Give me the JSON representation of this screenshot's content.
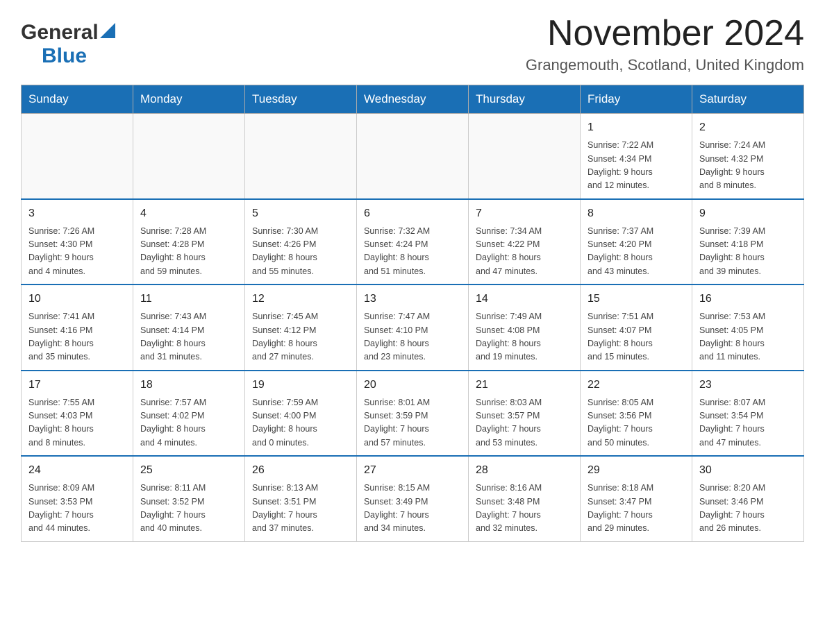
{
  "header": {
    "logo_general": "General",
    "logo_blue": "Blue",
    "month_title": "November 2024",
    "location": "Grangemouth, Scotland, United Kingdom"
  },
  "days_of_week": [
    "Sunday",
    "Monday",
    "Tuesday",
    "Wednesday",
    "Thursday",
    "Friday",
    "Saturday"
  ],
  "weeks": [
    [
      {
        "day": "",
        "info": ""
      },
      {
        "day": "",
        "info": ""
      },
      {
        "day": "",
        "info": ""
      },
      {
        "day": "",
        "info": ""
      },
      {
        "day": "",
        "info": ""
      },
      {
        "day": "1",
        "info": "Sunrise: 7:22 AM\nSunset: 4:34 PM\nDaylight: 9 hours\nand 12 minutes."
      },
      {
        "day": "2",
        "info": "Sunrise: 7:24 AM\nSunset: 4:32 PM\nDaylight: 9 hours\nand 8 minutes."
      }
    ],
    [
      {
        "day": "3",
        "info": "Sunrise: 7:26 AM\nSunset: 4:30 PM\nDaylight: 9 hours\nand 4 minutes."
      },
      {
        "day": "4",
        "info": "Sunrise: 7:28 AM\nSunset: 4:28 PM\nDaylight: 8 hours\nand 59 minutes."
      },
      {
        "day": "5",
        "info": "Sunrise: 7:30 AM\nSunset: 4:26 PM\nDaylight: 8 hours\nand 55 minutes."
      },
      {
        "day": "6",
        "info": "Sunrise: 7:32 AM\nSunset: 4:24 PM\nDaylight: 8 hours\nand 51 minutes."
      },
      {
        "day": "7",
        "info": "Sunrise: 7:34 AM\nSunset: 4:22 PM\nDaylight: 8 hours\nand 47 minutes."
      },
      {
        "day": "8",
        "info": "Sunrise: 7:37 AM\nSunset: 4:20 PM\nDaylight: 8 hours\nand 43 minutes."
      },
      {
        "day": "9",
        "info": "Sunrise: 7:39 AM\nSunset: 4:18 PM\nDaylight: 8 hours\nand 39 minutes."
      }
    ],
    [
      {
        "day": "10",
        "info": "Sunrise: 7:41 AM\nSunset: 4:16 PM\nDaylight: 8 hours\nand 35 minutes."
      },
      {
        "day": "11",
        "info": "Sunrise: 7:43 AM\nSunset: 4:14 PM\nDaylight: 8 hours\nand 31 minutes."
      },
      {
        "day": "12",
        "info": "Sunrise: 7:45 AM\nSunset: 4:12 PM\nDaylight: 8 hours\nand 27 minutes."
      },
      {
        "day": "13",
        "info": "Sunrise: 7:47 AM\nSunset: 4:10 PM\nDaylight: 8 hours\nand 23 minutes."
      },
      {
        "day": "14",
        "info": "Sunrise: 7:49 AM\nSunset: 4:08 PM\nDaylight: 8 hours\nand 19 minutes."
      },
      {
        "day": "15",
        "info": "Sunrise: 7:51 AM\nSunset: 4:07 PM\nDaylight: 8 hours\nand 15 minutes."
      },
      {
        "day": "16",
        "info": "Sunrise: 7:53 AM\nSunset: 4:05 PM\nDaylight: 8 hours\nand 11 minutes."
      }
    ],
    [
      {
        "day": "17",
        "info": "Sunrise: 7:55 AM\nSunset: 4:03 PM\nDaylight: 8 hours\nand 8 minutes."
      },
      {
        "day": "18",
        "info": "Sunrise: 7:57 AM\nSunset: 4:02 PM\nDaylight: 8 hours\nand 4 minutes."
      },
      {
        "day": "19",
        "info": "Sunrise: 7:59 AM\nSunset: 4:00 PM\nDaylight: 8 hours\nand 0 minutes."
      },
      {
        "day": "20",
        "info": "Sunrise: 8:01 AM\nSunset: 3:59 PM\nDaylight: 7 hours\nand 57 minutes."
      },
      {
        "day": "21",
        "info": "Sunrise: 8:03 AM\nSunset: 3:57 PM\nDaylight: 7 hours\nand 53 minutes."
      },
      {
        "day": "22",
        "info": "Sunrise: 8:05 AM\nSunset: 3:56 PM\nDaylight: 7 hours\nand 50 minutes."
      },
      {
        "day": "23",
        "info": "Sunrise: 8:07 AM\nSunset: 3:54 PM\nDaylight: 7 hours\nand 47 minutes."
      }
    ],
    [
      {
        "day": "24",
        "info": "Sunrise: 8:09 AM\nSunset: 3:53 PM\nDaylight: 7 hours\nand 44 minutes."
      },
      {
        "day": "25",
        "info": "Sunrise: 8:11 AM\nSunset: 3:52 PM\nDaylight: 7 hours\nand 40 minutes."
      },
      {
        "day": "26",
        "info": "Sunrise: 8:13 AM\nSunset: 3:51 PM\nDaylight: 7 hours\nand 37 minutes."
      },
      {
        "day": "27",
        "info": "Sunrise: 8:15 AM\nSunset: 3:49 PM\nDaylight: 7 hours\nand 34 minutes."
      },
      {
        "day": "28",
        "info": "Sunrise: 8:16 AM\nSunset: 3:48 PM\nDaylight: 7 hours\nand 32 minutes."
      },
      {
        "day": "29",
        "info": "Sunrise: 8:18 AM\nSunset: 3:47 PM\nDaylight: 7 hours\nand 29 minutes."
      },
      {
        "day": "30",
        "info": "Sunrise: 8:20 AM\nSunset: 3:46 PM\nDaylight: 7 hours\nand 26 minutes."
      }
    ]
  ]
}
